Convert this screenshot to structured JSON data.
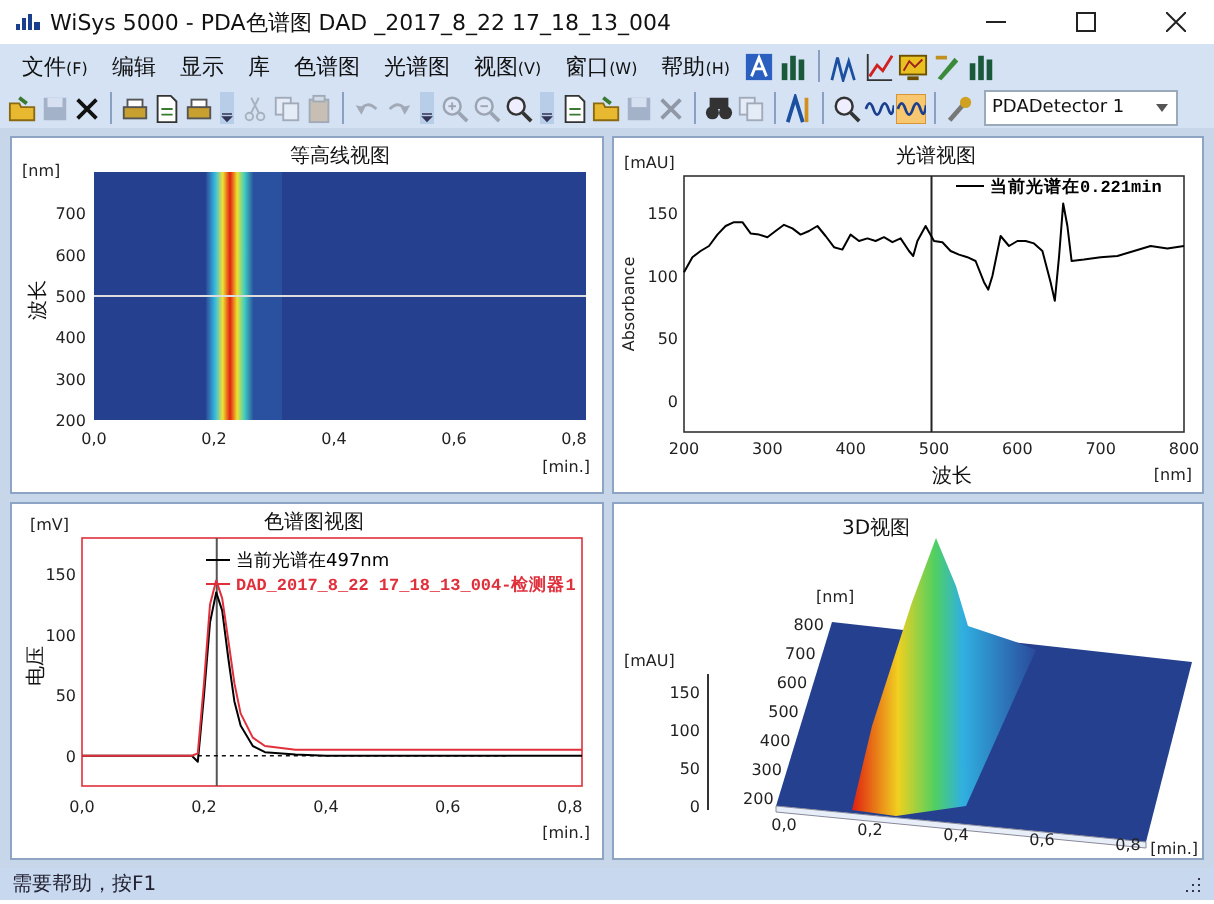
{
  "window": {
    "title": "WiSys 5000 - PDA色谱图  DAD _2017_8_22 17_18_13_004"
  },
  "menu": [
    {
      "label": "文件",
      "accel": "(F)"
    },
    {
      "label": "编辑"
    },
    {
      "label": "显示"
    },
    {
      "label": "库"
    },
    {
      "label": "色谱图"
    },
    {
      "label": "光谱图"
    },
    {
      "label": "视图",
      "accel": "(V)"
    },
    {
      "label": "窗口",
      "accel": "(W)"
    },
    {
      "label": "帮助",
      "accel": "(H)"
    }
  ],
  "menu_icons": [
    {
      "kind": "tile"
    },
    {
      "kind": "bars"
    },
    {
      "kind": "separator"
    },
    {
      "kind": "peaks"
    },
    {
      "kind": "chart"
    },
    {
      "kind": "monitor"
    },
    {
      "kind": "pen"
    },
    {
      "kind": "bars"
    }
  ],
  "toolbar": [
    {
      "kind": "folder",
      "disabled": false,
      "on": false
    },
    {
      "kind": "floppy",
      "disabled": true,
      "on": false
    },
    {
      "kind": "cross",
      "disabled": false,
      "on": false
    },
    {
      "kind": "separator"
    },
    {
      "kind": "printer",
      "disabled": false,
      "on": false
    },
    {
      "kind": "page",
      "disabled": false,
      "on": false
    },
    {
      "kind": "printer",
      "disabled": false,
      "on": false
    },
    {
      "kind": "more"
    },
    {
      "kind": "scissors",
      "disabled": true,
      "on": false
    },
    {
      "kind": "copy",
      "disabled": true,
      "on": false
    },
    {
      "kind": "clipboard",
      "disabled": true,
      "on": false
    },
    {
      "kind": "separator"
    },
    {
      "kind": "undo",
      "disabled": true,
      "on": false
    },
    {
      "kind": "redo",
      "disabled": true,
      "on": false
    },
    {
      "kind": "more"
    },
    {
      "kind": "zoom-in",
      "disabled": true,
      "on": false
    },
    {
      "kind": "zoom-out",
      "disabled": true,
      "on": false
    },
    {
      "kind": "magnifier",
      "disabled": false,
      "on": false
    },
    {
      "kind": "more"
    },
    {
      "kind": "page",
      "disabled": false,
      "on": false
    },
    {
      "kind": "folder",
      "disabled": false,
      "on": false
    },
    {
      "kind": "floppy",
      "disabled": true,
      "on": false
    },
    {
      "kind": "cross",
      "disabled": true,
      "on": false
    },
    {
      "kind": "separator"
    },
    {
      "kind": "binoculars",
      "disabled": false,
      "on": false
    },
    {
      "kind": "copy",
      "disabled": true,
      "on": false
    },
    {
      "kind": "separator"
    },
    {
      "kind": "peak",
      "disabled": false,
      "on": false
    },
    {
      "kind": "separator"
    },
    {
      "kind": "magnifier",
      "disabled": false,
      "on": false
    },
    {
      "kind": "wave",
      "disabled": false,
      "on": false
    },
    {
      "kind": "wave",
      "disabled": false,
      "on": true
    },
    {
      "kind": "separator"
    },
    {
      "kind": "wrench",
      "disabled": false,
      "on": false
    }
  ],
  "detector_select": {
    "value": "PDADetector 1"
  },
  "contour_view": {
    "title": "等高线视图",
    "y_unit": "[nm]",
    "y_label": "波长",
    "y_ticks": [
      "700",
      "600",
      "500",
      "400",
      "300",
      "200"
    ],
    "x_ticks": [
      "0,0",
      "0,2",
      "0,4",
      "0,6",
      "0,8"
    ],
    "x_unit": "[min.]"
  },
  "spectrum_view": {
    "y_unit": "[mAU]",
    "x_unit": "[nm]",
    "chart_data": {
      "type": "line",
      "title": "光谱视图",
      "xlabel": "波长",
      "ylabel": "Absorbance",
      "xlim": [
        200,
        800
      ],
      "ylim": [
        -25,
        180
      ],
      "xticks": [
        200,
        300,
        400,
        500,
        600,
        700,
        800
      ],
      "yticks": [
        0,
        50,
        100,
        150
      ],
      "x": [
        200,
        210,
        220,
        230,
        240,
        250,
        260,
        270,
        280,
        290,
        300,
        310,
        320,
        330,
        340,
        350,
        360,
        370,
        380,
        390,
        400,
        410,
        420,
        430,
        440,
        450,
        460,
        470,
        475,
        480,
        490,
        500,
        510,
        520,
        530,
        540,
        550,
        560,
        565,
        570,
        580,
        590,
        600,
        610,
        620,
        630,
        640,
        645,
        650,
        655,
        660,
        665,
        680,
        700,
        720,
        740,
        760,
        780,
        800
      ],
      "series": [
        {
          "name": "当前光谱在0.221min",
          "color": "#000000",
          "values": [
            103,
            115,
            120,
            124,
            133,
            140,
            143,
            143,
            134,
            133,
            131,
            136,
            141,
            138,
            133,
            136,
            140,
            132,
            123,
            121,
            133,
            128,
            130,
            128,
            131,
            127,
            130,
            120,
            116,
            128,
            140,
            128,
            127,
            120,
            117,
            115,
            112,
            95,
            89,
            100,
            132,
            124,
            128,
            128,
            126,
            120,
            95,
            80,
            115,
            158,
            140,
            112,
            113,
            115,
            116,
            120,
            124,
            122,
            124
          ]
        }
      ],
      "legend": "upper right"
    }
  },
  "chromatogram_view": {
    "y_unit": "[mV]",
    "x_unit": "[min.]",
    "chart_data": {
      "type": "line",
      "title": "色谱图视图",
      "ylabel": "电压",
      "xlim": [
        0,
        0.82
      ],
      "ylim": [
        -25,
        180
      ],
      "xticks": [
        {
          "value": 0,
          "label": "0,0"
        },
        {
          "value": 0.2,
          "label": "0,2"
        },
        {
          "value": 0.4,
          "label": "0,4"
        },
        {
          "value": 0.6,
          "label": "0,6"
        },
        {
          "value": 0.8,
          "label": "0,8"
        }
      ],
      "yticks": [
        0,
        50,
        100,
        150
      ],
      "x": [
        0,
        0.1,
        0.18,
        0.19,
        0.2,
        0.21,
        0.22,
        0.23,
        0.24,
        0.25,
        0.26,
        0.28,
        0.3,
        0.35,
        0.4,
        0.5,
        0.6,
        0.7,
        0.74,
        0.82
      ],
      "series": [
        {
          "name": "当前光谱在497nm",
          "color": "#000000",
          "values": [
            0,
            0,
            0,
            -5,
            50,
            110,
            135,
            120,
            80,
            45,
            25,
            8,
            3,
            1,
            0,
            0,
            0,
            0,
            0,
            0
          ]
        },
        {
          "name": "DAD_2017_8_22 17_18_13_004-检测器1",
          "color": "#e0303c",
          "values": [
            0,
            0,
            0,
            2,
            60,
            125,
            145,
            130,
            95,
            60,
            35,
            15,
            8,
            5,
            5,
            5,
            5,
            5,
            5,
            5
          ]
        }
      ],
      "ref_lines": [
        {
          "axis": "x",
          "value": 0.221
        },
        {
          "axis": "y",
          "value": 0
        }
      ],
      "legend": "upper center"
    }
  },
  "view_3d": {
    "title": "3D视图",
    "wavelength_unit": "[nm]",
    "wavelength_ticks": [
      "800",
      "700",
      "600",
      "500",
      "400",
      "300",
      "200"
    ],
    "intensity_unit": "[mAU]",
    "intensity_ticks": [
      "150",
      "100",
      "50",
      "0"
    ],
    "time_ticks": [
      "0,0",
      "0,2",
      "0,4",
      "0,6",
      "0,8"
    ],
    "time_unit": "[min.]"
  },
  "status_bar": {
    "text": "需要帮助，按F1"
  }
}
